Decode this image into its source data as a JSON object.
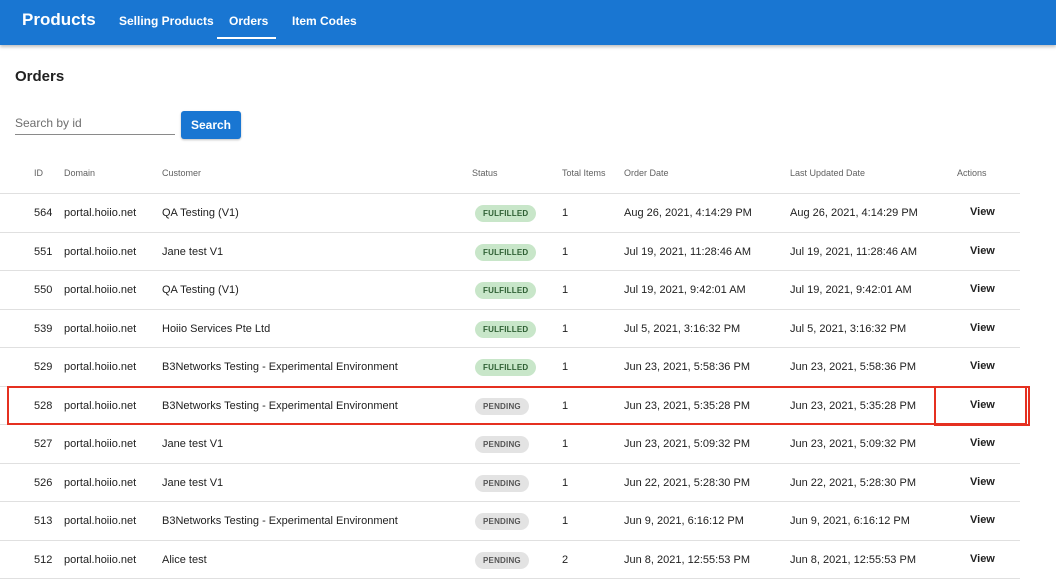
{
  "app": {
    "brand": "Products",
    "nav": [
      {
        "label": "Selling Products"
      },
      {
        "label": "Orders"
      },
      {
        "label": "Item Codes"
      }
    ],
    "active_nav": "Orders"
  },
  "page": {
    "title": "Orders"
  },
  "search": {
    "placeholder": "Search by id",
    "value": "",
    "button_label": "Search"
  },
  "table": {
    "columns": [
      "ID",
      "Domain",
      "Customer",
      "Status",
      "Total Items",
      "Order Date",
      "Last Updated Date",
      "Actions"
    ],
    "rows": [
      {
        "id": "564",
        "domain": "portal.hoiio.net",
        "customer": "QA Testing (V1)",
        "status": "FULFILLED",
        "items": "1",
        "order_date": "Aug 26, 2021, 4:14:29 PM",
        "updated": "Aug 26, 2021, 4:14:29 PM",
        "action": "View"
      },
      {
        "id": "551",
        "domain": "portal.hoiio.net",
        "customer": "Jane test V1",
        "status": "FULFILLED",
        "items": "1",
        "order_date": "Jul 19, 2021, 11:28:46 AM",
        "updated": "Jul 19, 2021, 11:28:46 AM",
        "action": "View"
      },
      {
        "id": "550",
        "domain": "portal.hoiio.net",
        "customer": "QA Testing (V1)",
        "status": "FULFILLED",
        "items": "1",
        "order_date": "Jul 19, 2021, 9:42:01 AM",
        "updated": "Jul 19, 2021, 9:42:01 AM",
        "action": "View"
      },
      {
        "id": "539",
        "domain": "portal.hoiio.net",
        "customer": "Hoiio Services Pte Ltd",
        "status": "FULFILLED",
        "items": "1",
        "order_date": "Jul 5, 2021, 3:16:32 PM",
        "updated": "Jul 5, 2021, 3:16:32 PM",
        "action": "View"
      },
      {
        "id": "529",
        "domain": "portal.hoiio.net",
        "customer": "B3Networks Testing - Experimental Environment",
        "status": "FULFILLED",
        "items": "1",
        "order_date": "Jun 23, 2021, 5:58:36 PM",
        "updated": "Jun 23, 2021, 5:58:36 PM",
        "action": "View"
      },
      {
        "id": "528",
        "domain": "portal.hoiio.net",
        "customer": "B3Networks Testing - Experimental Environment",
        "status": "PENDING",
        "items": "1",
        "order_date": "Jun 23, 2021, 5:35:28 PM",
        "updated": "Jun 23, 2021, 5:35:28 PM",
        "action": "View"
      },
      {
        "id": "527",
        "domain": "portal.hoiio.net",
        "customer": "Jane test V1",
        "status": "PENDING",
        "items": "1",
        "order_date": "Jun 23, 2021, 5:09:32 PM",
        "updated": "Jun 23, 2021, 5:09:32 PM",
        "action": "View"
      },
      {
        "id": "526",
        "domain": "portal.hoiio.net",
        "customer": "Jane test V1",
        "status": "PENDING",
        "items": "1",
        "order_date": "Jun 22, 2021, 5:28:30 PM",
        "updated": "Jun 22, 2021, 5:28:30 PM",
        "action": "View"
      },
      {
        "id": "513",
        "domain": "portal.hoiio.net",
        "customer": "B3Networks Testing - Experimental Environment",
        "status": "PENDING",
        "items": "1",
        "order_date": "Jun 9, 2021, 6:16:12 PM",
        "updated": "Jun 9, 2021, 6:16:12 PM",
        "action": "View"
      },
      {
        "id": "512",
        "domain": "portal.hoiio.net",
        "customer": "Alice test",
        "status": "PENDING",
        "items": "2",
        "order_date": "Jun 8, 2021, 12:55:53 PM",
        "updated": "Jun 8, 2021, 12:55:53 PM",
        "action": "View"
      }
    ]
  },
  "colors": {
    "primary": "#1976d2",
    "fulfilled_chip": "#c8e6c9",
    "pending_chip": "#e3e3e3",
    "highlight": "#e53020"
  }
}
